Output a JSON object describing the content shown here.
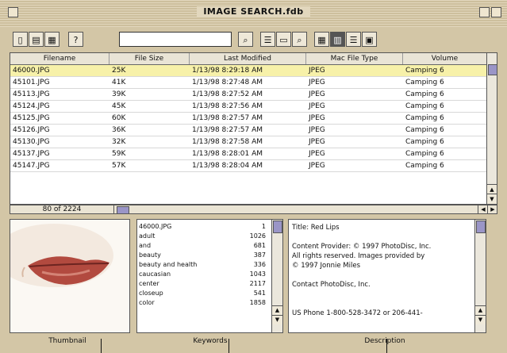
{
  "window": {
    "title": "IMAGE SEARCH.fdb"
  },
  "toolbar": {
    "search_value": "",
    "left_buttons": [
      "new-file-icon",
      "open-folder-icon",
      "print-icon",
      "help-icon"
    ],
    "right_buttons": [
      "find-icon",
      "list-options-icon",
      "window-icon",
      "zoom-icon",
      "icon-view-icon",
      "column-view-icon",
      "list-view-icon",
      "split-view-icon"
    ]
  },
  "table": {
    "columns": [
      "Filename",
      "File Size",
      "Last Modified",
      "Mac File Type",
      "Volume"
    ],
    "rows": [
      [
        "46000.JPG",
        "25K",
        "1/13/98 8:29:18 AM",
        "JPEG",
        "Camping 6"
      ],
      [
        "45101.JPG",
        "41K",
        "1/13/98 8:27:48 AM",
        "JPEG",
        "Camping 6"
      ],
      [
        "45113.JPG",
        "39K",
        "1/13/98 8:27:52 AM",
        "JPEG",
        "Camping 6"
      ],
      [
        "45124.JPG",
        "45K",
        "1/13/98 8:27:56 AM",
        "JPEG",
        "Camping 6"
      ],
      [
        "45125.JPG",
        "60K",
        "1/13/98 8:27:57 AM",
        "JPEG",
        "Camping 6"
      ],
      [
        "45126.JPG",
        "36K",
        "1/13/98 8:27:57 AM",
        "JPEG",
        "Camping 6"
      ],
      [
        "45130.JPG",
        "32K",
        "1/13/98 8:27:58 AM",
        "JPEG",
        "Camping 6"
      ],
      [
        "45137.JPG",
        "59K",
        "1/13/98 8:28:01 AM",
        "JPEG",
        "Camping 6"
      ],
      [
        "45147.JPG",
        "57K",
        "1/13/98 8:28:04 AM",
        "JPEG",
        "Camping 6"
      ]
    ]
  },
  "status": {
    "count": "80 of 2224"
  },
  "keywords": [
    [
      "46000.JPG",
      "1"
    ],
    [
      "adult",
      "1026"
    ],
    [
      "and",
      "681"
    ],
    [
      "beauty",
      "387"
    ],
    [
      "beauty and health",
      "336"
    ],
    [
      "caucasian",
      "1043"
    ],
    [
      "center",
      "2117"
    ],
    [
      "closeup",
      "541"
    ],
    [
      "color",
      "1858"
    ]
  ],
  "description": {
    "title_line": "Title: Red Lips",
    "provider_lines": [
      "Content Provider: © 1997 PhotoDisc, Inc.",
      "All rights reserved.  Images provided by",
      "© 1997 Jonnie Miles"
    ],
    "contact_line": "Contact PhotoDisc, Inc.",
    "phone_line": "US Phone 1-800-528-3472 or 206-441-"
  },
  "labels": {
    "thumbnail": "Thumbnail",
    "keywords": "Keywords",
    "description": "Description"
  },
  "colors": {
    "selection": "#f7f1a9",
    "scroll_thumb": "#9a95c7",
    "chrome": "#d3c6a6"
  }
}
